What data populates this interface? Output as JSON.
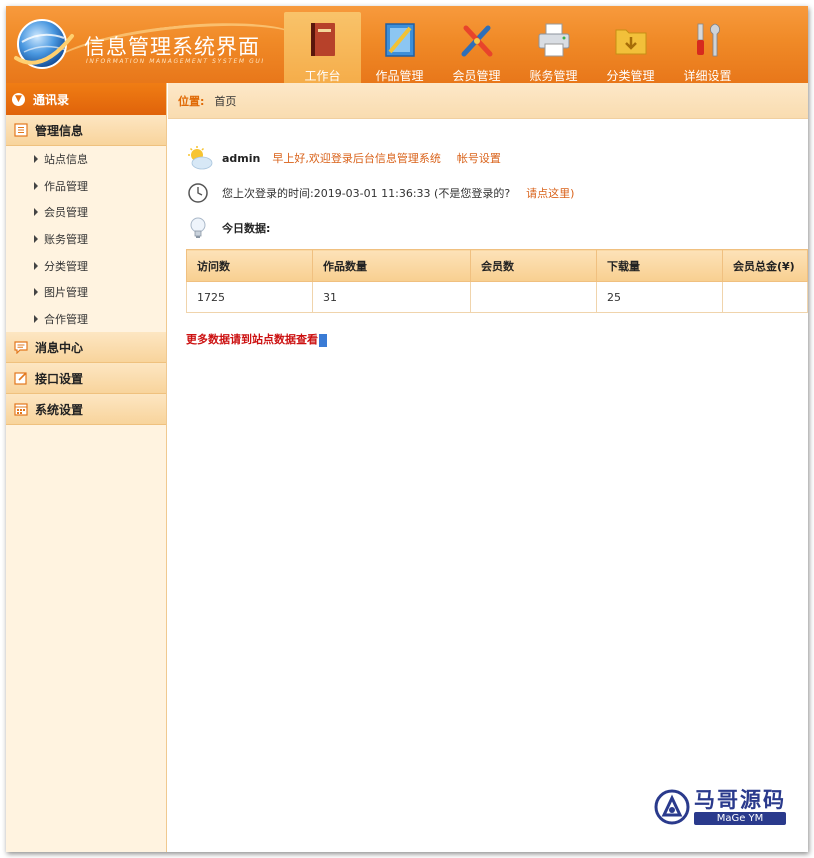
{
  "header": {
    "title": "信息管理系统界面",
    "subtitle": "INFORMATION MANAGEMENT SYSTEM GUI"
  },
  "nav": [
    {
      "label": "工作台",
      "icon": "book-icon",
      "active": true
    },
    {
      "label": "作品管理",
      "icon": "ruler-board-icon",
      "active": false
    },
    {
      "label": "会员管理",
      "icon": "tools-icon",
      "active": false
    },
    {
      "label": "账务管理",
      "icon": "printer-icon",
      "active": false
    },
    {
      "label": "分类管理",
      "icon": "folder-icon",
      "active": false
    },
    {
      "label": "详细设置",
      "icon": "wrench-screwdriver-icon",
      "active": false
    }
  ],
  "sidebar": {
    "top_label": "通讯录",
    "management_label": "管理信息",
    "items": [
      {
        "label": "站点信息"
      },
      {
        "label": "作品管理"
      },
      {
        "label": "会员管理"
      },
      {
        "label": "账务管理"
      },
      {
        "label": "分类管理"
      },
      {
        "label": "图片管理"
      },
      {
        "label": "合作管理"
      }
    ],
    "messages_label": "消息中心",
    "interface_label": "接口设置",
    "system_label": "系统设置"
  },
  "breadcrumb": {
    "label": "位置:",
    "page": "首页"
  },
  "welcome": {
    "user": "admin",
    "message": "早上好,欢迎登录后台信息管理系统",
    "account_link": "帐号设置"
  },
  "last_login": {
    "text": "您上次登录的时间:2019-03-01 11:36:33 (不是您登录的?",
    "link": "请点这里)"
  },
  "today": {
    "label": "今日数据:"
  },
  "stats_table": {
    "headers": [
      "访问数",
      "作品数量",
      "会员数",
      "下载量",
      "会员总金(¥)"
    ],
    "row": [
      "1725",
      "31",
      "",
      "25",
      ""
    ]
  },
  "more_link": "更多数据请到站点数据查看",
  "watermark": {
    "cn": "马哥源码",
    "en": "MaGe YM"
  },
  "colors": {
    "header_orange": "#f08a27",
    "sidebar_bg": "#fff3e0",
    "accent": "#e06a06",
    "link": "#d9621a",
    "more_red": "#cc1111"
  }
}
